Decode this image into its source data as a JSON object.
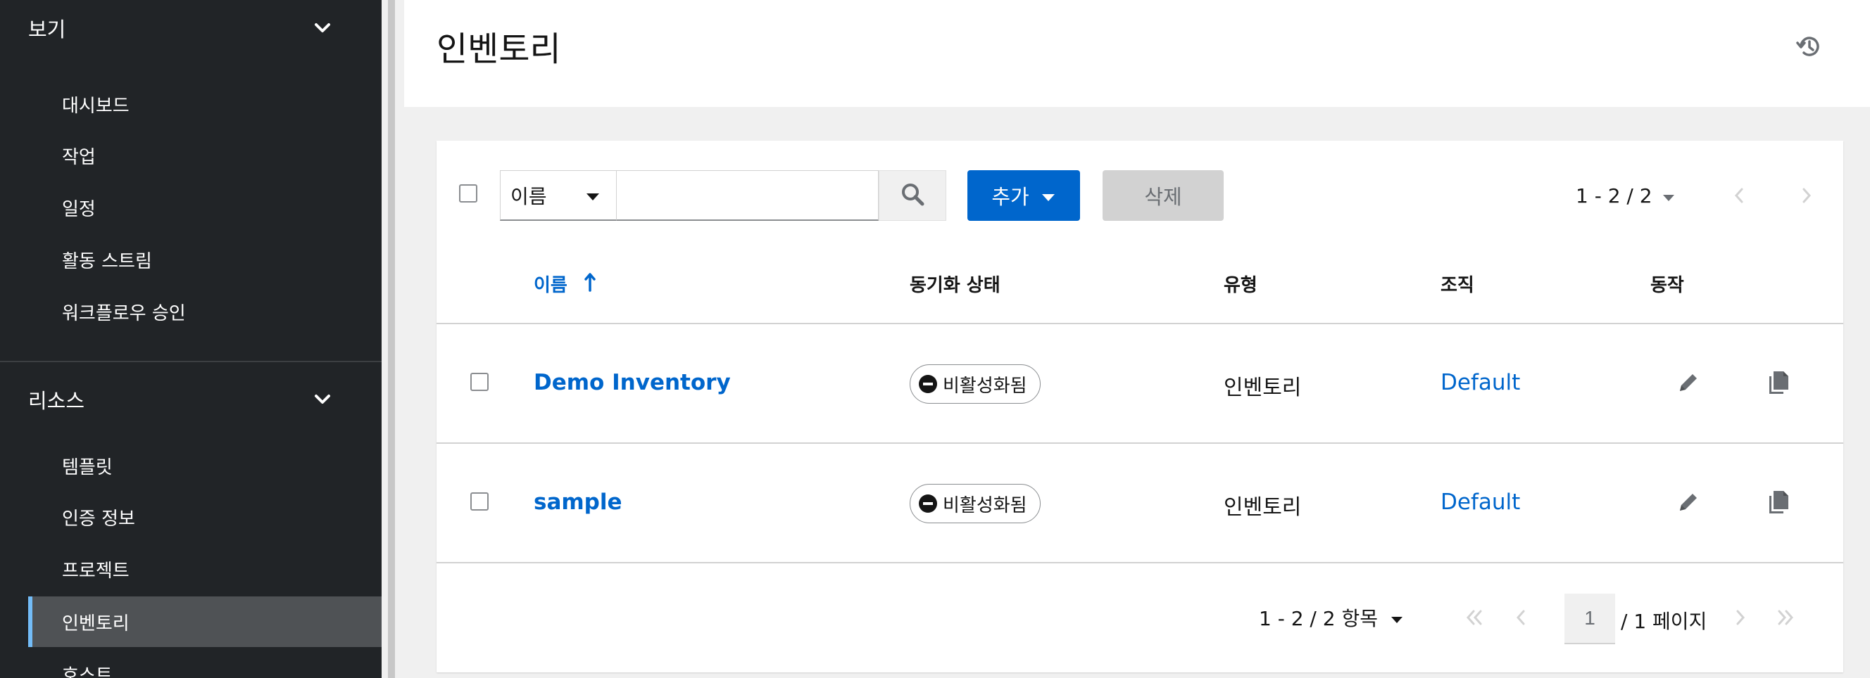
{
  "sidebar": {
    "groups": [
      {
        "label": "보기",
        "items": [
          "대시보드",
          "작업",
          "일정",
          "활동 스트림",
          "워크플로우 승인"
        ]
      },
      {
        "label": "리소스",
        "items": [
          "템플릿",
          "인증 정보",
          "프로젝트",
          "인벤토리",
          "호스트"
        ]
      }
    ],
    "active_item": "인벤토리"
  },
  "header": {
    "title": "인벤토리",
    "history_icon": "history-icon"
  },
  "toolbar": {
    "filter_selected": "이름",
    "search_value": "",
    "add_label": "추가",
    "delete_label": "삭제",
    "pagination_range": "1 - 2 / 2"
  },
  "table": {
    "columns": [
      "이름",
      "동기화 상태",
      "유형",
      "조직",
      "동작"
    ],
    "sort": {
      "column": "이름",
      "direction": "ascending"
    },
    "rows": [
      {
        "name": "Demo Inventory",
        "sync_status": "비활성화됨",
        "type": "인벤토리",
        "organization": "Default"
      },
      {
        "name": "sample",
        "sync_status": "비활성화됨",
        "type": "인벤토리",
        "organization": "Default"
      }
    ]
  },
  "pagination": {
    "range": "1 - 2 / 2 항목",
    "page": "1",
    "total": "/ 1 페이지"
  },
  "colors": {
    "sidebar_bg": "#212427",
    "link": "#0066cc",
    "primary_button": "#0066cc",
    "active_accent": "#73bcf7"
  }
}
